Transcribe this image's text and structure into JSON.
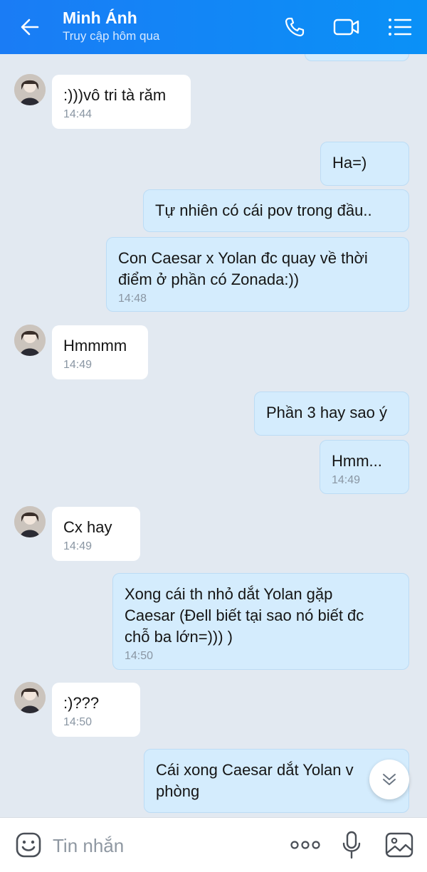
{
  "header": {
    "title": "Minh Ánh",
    "subtitle": "Truy cập hôm qua",
    "back_icon": "arrow-left-icon",
    "call_icon": "phone-icon",
    "video_icon": "video-icon",
    "menu_icon": "list-menu-icon"
  },
  "messages": [
    {
      "dir": "in",
      "lines": [
        ":)))vô tri tà răm"
      ],
      "time": "14:44"
    },
    {
      "dir": "out",
      "lines": [
        "Ha=)"
      ],
      "time": ""
    },
    {
      "dir": "out",
      "lines": [
        "Tự nhiên có cái pov trong đầu.."
      ],
      "time": ""
    },
    {
      "dir": "out",
      "lines": [
        "Con Caesar x Yolan đc quay về thời",
        "điểm ở phần có Zonada:))"
      ],
      "time": "14:48"
    },
    {
      "dir": "in",
      "lines": [
        "Hmmmm"
      ],
      "time": "14:49"
    },
    {
      "dir": "out",
      "lines": [
        "Phần 3 hay sao ý"
      ],
      "time": ""
    },
    {
      "dir": "out",
      "lines": [
        "Hmm..."
      ],
      "time": "14:49"
    },
    {
      "dir": "in",
      "lines": [
        "Cx hay"
      ],
      "time": "14:49"
    },
    {
      "dir": "out",
      "lines": [
        "Xong cái th nhỏ dắt Yolan gặp",
        "Caesar (Đell biết tại sao nó biết đc",
        "chỗ ba lớn=))) )"
      ],
      "time": "14:50"
    },
    {
      "dir": "in",
      "lines": [
        ":)???"
      ],
      "time": "14:50"
    },
    {
      "dir": "out",
      "lines": [
        "Cái xong Caesar dắt Yolan v",
        "phòng"
      ],
      "time": ""
    }
  ],
  "composer": {
    "placeholder": "Tin nhắn",
    "sticker_icon": "sticker-smile-icon",
    "more_icon": "more-dots-icon",
    "mic_icon": "microphone-icon",
    "image_icon": "image-icon"
  },
  "scroll_down_icon": "chevrons-down-icon",
  "colors": {
    "header": "#1a7cf5",
    "outgoing_bubble": "#d4ecfd",
    "incoming_bubble": "#ffffff",
    "background": "#e2e9f1"
  }
}
